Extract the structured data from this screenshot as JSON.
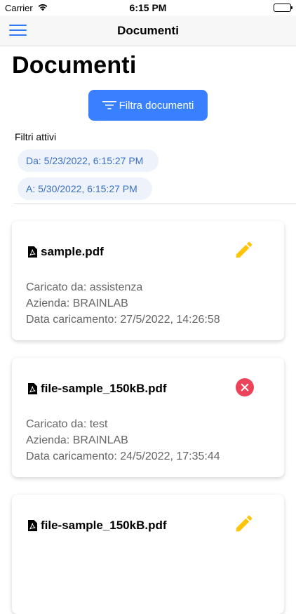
{
  "status_bar": {
    "carrier": "Carrier",
    "time": "6:15 PM"
  },
  "nav": {
    "title": "Documenti"
  },
  "page": {
    "title": "Documenti"
  },
  "filter_button": {
    "label": "Filtra documenti"
  },
  "active_filters": {
    "label": "Filtri attivi",
    "from": "Da: 5/23/2022, 6:15:27 PM",
    "to": "A: 5/30/2022, 6:15:27 PM"
  },
  "documents": [
    {
      "filename": "sample.pdf",
      "uploaded_by": "Caricato da: assistenza",
      "company": "Azienda: BRAINLAB",
      "upload_date": "Data caricamento: 27/5/2022, 14:26:58",
      "action_icon": "pencil-icon"
    },
    {
      "filename": "file-sample_150kB.pdf",
      "uploaded_by": "Caricato da: test",
      "company": "Azienda: BRAINLAB",
      "upload_date": "Data caricamento: 24/5/2022, 17:35:44",
      "action_icon": "close-circle-icon"
    },
    {
      "filename": "file-sample_150kB.pdf",
      "action_icon": "pencil-icon"
    }
  ],
  "colors": {
    "primary": "#3880ff",
    "danger": "#eb445a",
    "warning": "#ffc409",
    "chip_text": "#3a6fc0"
  }
}
